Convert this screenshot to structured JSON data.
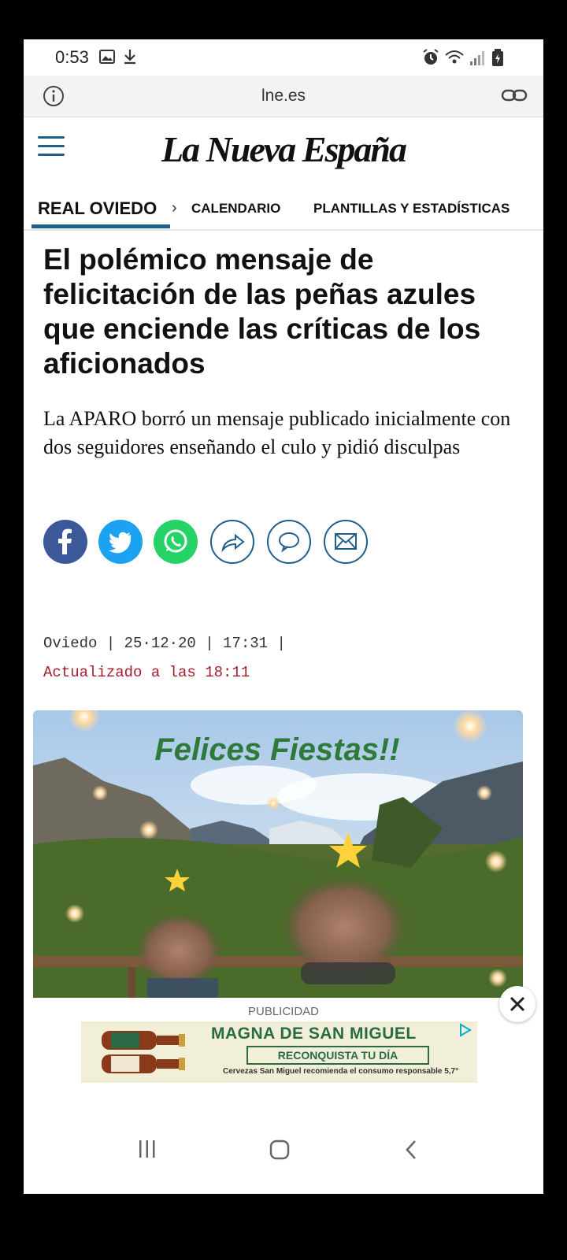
{
  "status_bar": {
    "time": "0:53"
  },
  "url_bar": {
    "url": "lne.es"
  },
  "header": {
    "logo": "La Nueva España"
  },
  "section_nav": {
    "active": "REAL OVIEDO",
    "items": [
      "CALENDARIO",
      "PLANTILLAS Y ESTADÍSTICAS"
    ]
  },
  "article": {
    "headline": "El polémico mensaje de felicitación de las peñas azules que enciende las críticas de los aficionados",
    "subtitle": "La APARO borró un mensaje publicado inicialmente con dos seguidores enseñando el culo y pidió disculpas",
    "meta": "Oviedo | 25·12·20 | 17:31 |",
    "updated": "Actualizado a las 18:11",
    "image_caption_text": "Felices Fiestas!!"
  },
  "share_buttons": [
    "facebook-icon",
    "twitter-icon",
    "whatsapp-icon",
    "share-icon",
    "comment-icon",
    "email-icon"
  ],
  "ad": {
    "label": "PUBLICIDAD",
    "brand": "MAGNA DE SAN MIGUEL",
    "cta": "RECONQUISTA TU DÍA",
    "legal": "Cervezas San Miguel recomienda el consumo responsable 5,7°"
  },
  "colors": {
    "accent": "#1f5f8b",
    "updated": "#a51d2d",
    "facebook": "#3b5998",
    "twitter": "#1da1f2",
    "whatsapp": "#25d366"
  }
}
